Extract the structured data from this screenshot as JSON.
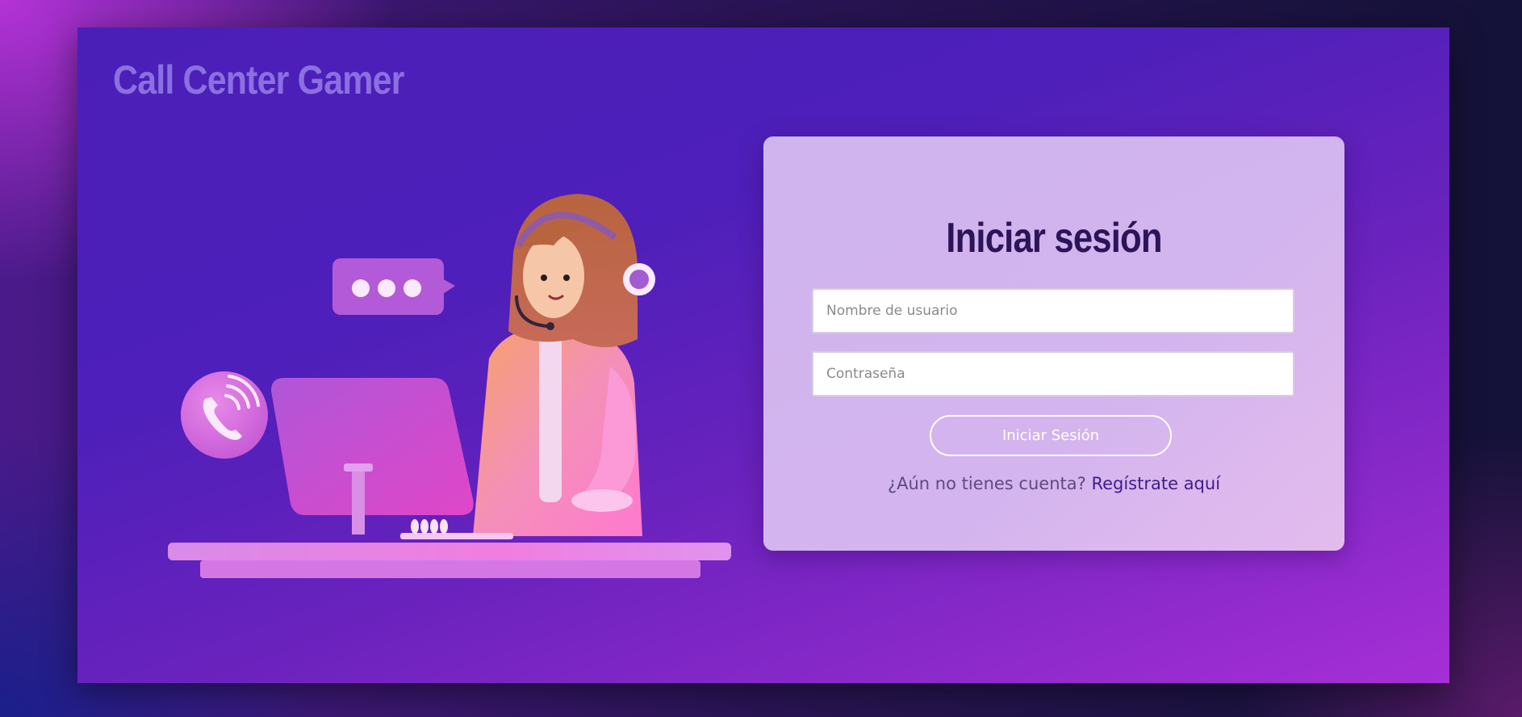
{
  "brand": {
    "title": "Call Center Gamer"
  },
  "login": {
    "title": "Iniciar sesión",
    "username_placeholder": "Nombre de usuario",
    "password_placeholder": "Contraseña",
    "submit_label": "Iniciar Sesión",
    "signup_prompt": "¿Aún no tienes cuenta?",
    "signup_link": "Regístrate aquí"
  },
  "colors": {
    "frame_start": "#4a1fb8",
    "frame_end": "#a62fd6",
    "brand_text": "#8c6fe0",
    "card_bg": "#e0c8f3",
    "title_text": "#2c1459",
    "link_text": "#3d1d8c"
  },
  "illustration": {
    "icons": [
      "chat-bubble-icon",
      "phone-call-icon",
      "headset-agent",
      "computer-monitor-icon",
      "desk"
    ]
  }
}
